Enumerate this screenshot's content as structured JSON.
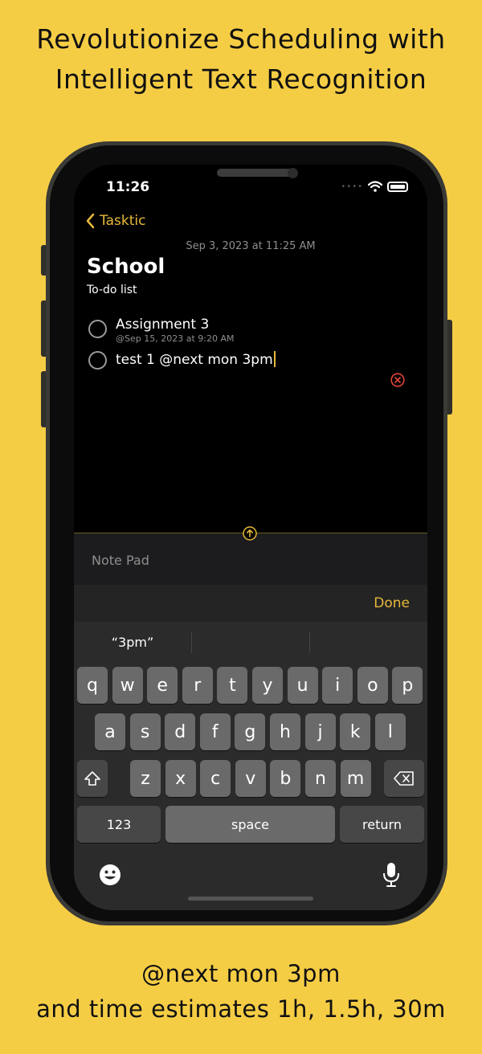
{
  "promo": {
    "headline_line1": "Revolutionize Scheduling with",
    "headline_line2": "Intelligent Text Recognition",
    "footer_line1": "@next mon 3pm",
    "footer_line2": "and time estimates 1h, 1.5h, 30m"
  },
  "status_bar": {
    "time": "11:26",
    "icons": [
      "signal-dots-icon",
      "wifi-icon",
      "battery-icon"
    ]
  },
  "nav": {
    "back_label": "Tasktic",
    "back_icon": "chevron-left-icon"
  },
  "note": {
    "date": "Sep 3, 2023 at 11:25 AM",
    "title": "School",
    "subtitle": "To-do list"
  },
  "todos": [
    {
      "text": "Assignment 3",
      "meta": "@Sep 15, 2023 at 9:20 AM"
    },
    {
      "text": "test 1 @next mon 3pm",
      "meta": ""
    }
  ],
  "notepad": {
    "label": "Note Pad"
  },
  "toolbar": {
    "done_label": "Done"
  },
  "keyboard": {
    "suggestions": [
      "“3pm”",
      "",
      ""
    ],
    "row1": [
      "q",
      "w",
      "e",
      "r",
      "t",
      "y",
      "u",
      "i",
      "o",
      "p"
    ],
    "row2": [
      "a",
      "s",
      "d",
      "f",
      "g",
      "h",
      "j",
      "k",
      "l"
    ],
    "row3": [
      "z",
      "x",
      "c",
      "v",
      "b",
      "n",
      "m"
    ],
    "numbers_label": "123",
    "space_label": "space",
    "return_label": "return"
  },
  "colors": {
    "background": "#f5cd45",
    "accent": "#e7b83a",
    "clear": "#e0453a"
  }
}
